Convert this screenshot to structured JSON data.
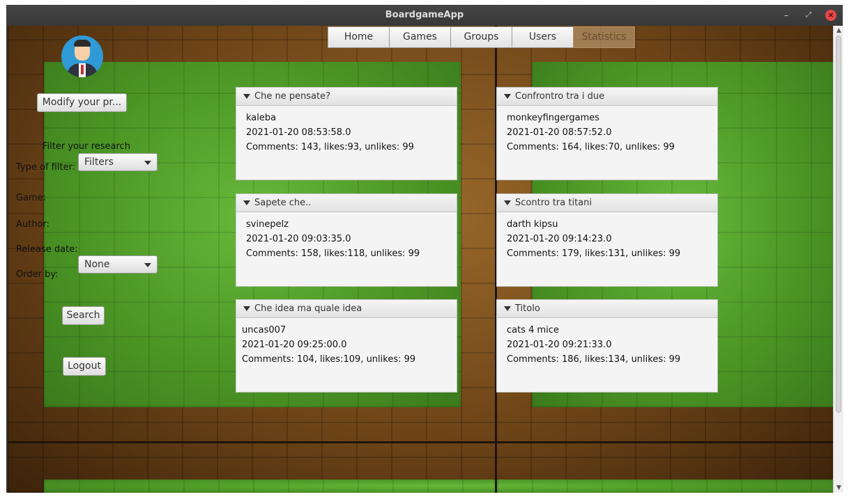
{
  "window": {
    "title": "BoardgameApp"
  },
  "nav": {
    "items": [
      {
        "label": "Home"
      },
      {
        "label": "Games"
      },
      {
        "label": "Groups"
      },
      {
        "label": "Users"
      },
      {
        "label": "Statistics"
      }
    ],
    "active": "Statistics"
  },
  "sidebar": {
    "modify_label": "Modify your pr...",
    "filter_heading": "Filter your research",
    "type_of_filter_label": "Type of filter:",
    "type_of_filter_value": "Filters",
    "game_label": "Game:",
    "author_label": "Author:",
    "release_date_label": "Release date:",
    "order_by_label": "Order by:",
    "order_by_value": "None",
    "search_label": "Search",
    "logout_label": "Logout"
  },
  "posts": [
    {
      "title": "Che ne pensate?",
      "author": "kaleba",
      "date": "2021-01-20 08:53:58.0",
      "stats": "Comments: 143, likes:93, unlikes: 99"
    },
    {
      "title": "Confrontro tra i due",
      "author": "monkeyfingergames",
      "date": "2021-01-20 08:57:52.0",
      "stats": "Comments: 164, likes:70, unlikes: 99"
    },
    {
      "title": "Sapete che..",
      "author": "svinepelz",
      "date": "2021-01-20 09:03:35.0",
      "stats": "Comments: 158, likes:118, unlikes: 99"
    },
    {
      "title": "Scontro tra titani",
      "author": "darth kipsu",
      "date": "2021-01-20 09:14:23.0",
      "stats": "Comments: 179, likes:131, unlikes: 99"
    },
    {
      "title": "Che idea ma quale idea",
      "author": "uncas007",
      "date": "2021-01-20 09:25:00.0",
      "stats": "Comments: 104, likes:109, unlikes: 99"
    },
    {
      "title": "Titolo",
      "author": "cats 4 mice",
      "date": "2021-01-20 09:21:33.0",
      "stats": "Comments: 186, likes:134, unlikes: 99"
    }
  ]
}
